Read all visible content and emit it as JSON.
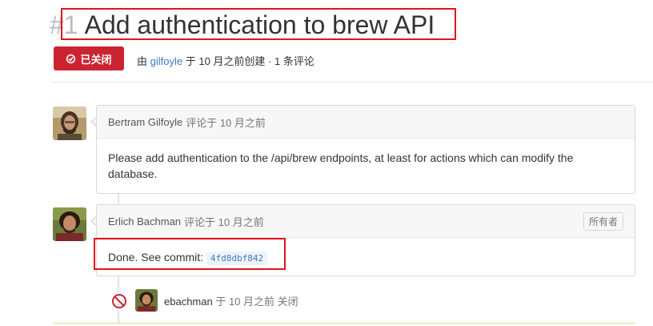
{
  "issue": {
    "number": "#1",
    "title": "Add authentication to brew API",
    "status_label": "已关闭",
    "meta": {
      "prefix": "由",
      "author": "gilfoyle",
      "middle": "于 10 月之前创建 · 1 条评论"
    }
  },
  "comments": [
    {
      "author": "Bertram Gilfoyle",
      "time_text": "评论于 10 月之前",
      "body": "Please add authentication to the /api/brew endpoints, at least for actions which can modify the database."
    },
    {
      "author": "Erlich Bachman",
      "time_text": "评论于 10 月之前",
      "badge": "所有者",
      "body_prefix": "Done. See commit:",
      "commit": "4fd8dbf842"
    }
  ],
  "event": {
    "actor": "ebachman",
    "text": "于 10 月之前",
    "action": "关闭"
  },
  "colors": {
    "closed_badge": "#cb2431",
    "link": "#4078c0",
    "highlight_box": "#e0151c"
  }
}
